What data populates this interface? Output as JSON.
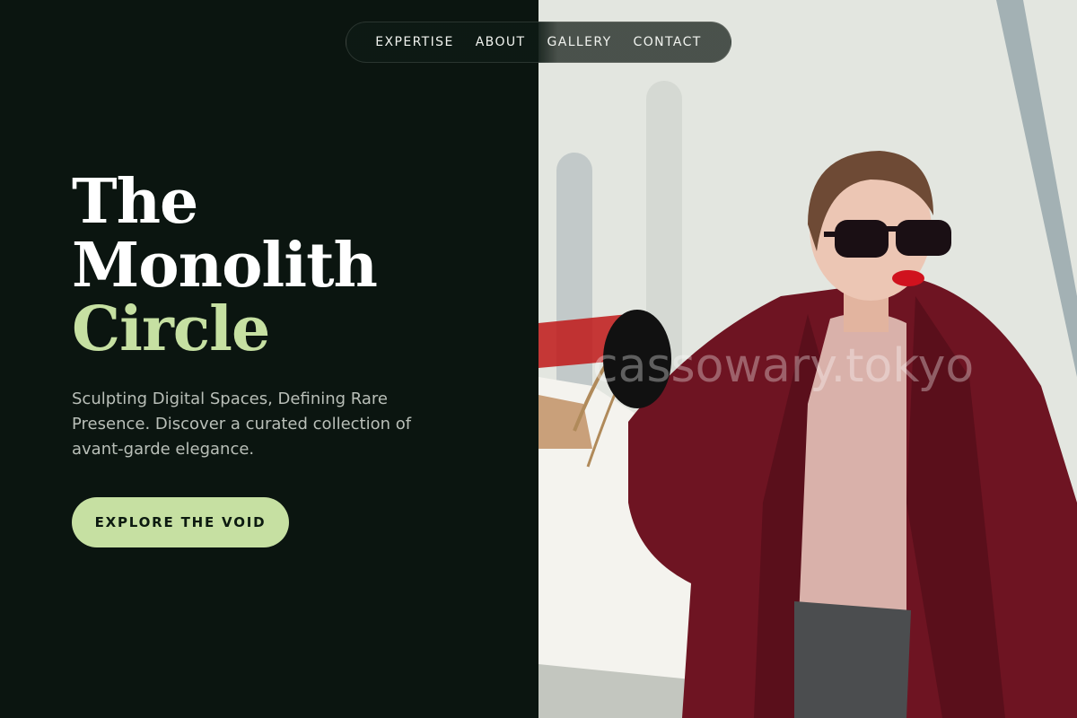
{
  "nav": {
    "items": [
      {
        "label": "EXPERTISE"
      },
      {
        "label": "ABOUT"
      },
      {
        "label": "GALLERY"
      },
      {
        "label": "CONTACT"
      }
    ]
  },
  "hero": {
    "title_line1": "The",
    "title_line2": "Monolith",
    "title_line3": "Circle",
    "subtitle": "Sculpting Digital Spaces, Defining Rare Presence. Discover a curated collection of avant-garde elegance.",
    "cta_label": "EXPLORE THE VOID"
  },
  "image": {
    "watermark": "cassowary.tokyo",
    "alt": "woman in burgundy coat and sunglasses holding shopping bags"
  },
  "colors": {
    "background": "#0b1510",
    "accent": "#c6e0a2",
    "text": "#ffffff",
    "muted_text": "#b9bfb8"
  }
}
